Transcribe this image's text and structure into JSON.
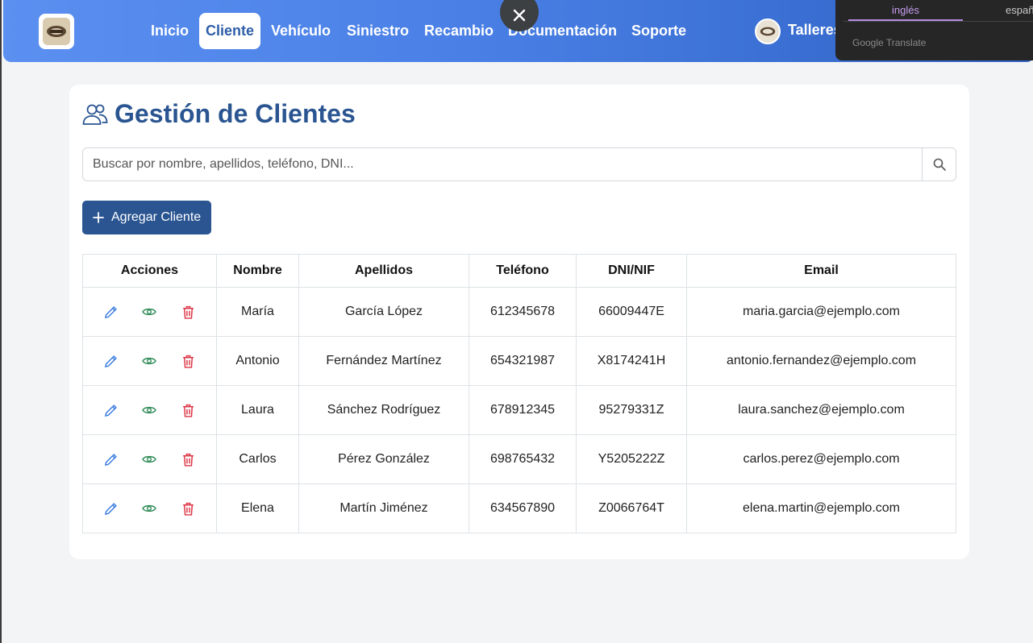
{
  "navbar": {
    "items": [
      {
        "label": "Inicio",
        "active": false
      },
      {
        "label": "Cliente",
        "active": true
      },
      {
        "label": "Vehículo",
        "active": false
      },
      {
        "label": "Siniestro",
        "active": false
      },
      {
        "label": "Recambio",
        "active": false
      },
      {
        "label": "Documentación",
        "active": false
      },
      {
        "label": "Soporte",
        "active": false
      }
    ],
    "user_label": "Talleres"
  },
  "translate": {
    "tab_selected": "inglés",
    "tab_other": "español",
    "brand": "Google Translate"
  },
  "page": {
    "title": "Gestión de Clientes",
    "title_icon": "users-icon",
    "search_placeholder": "Buscar por nombre, apellidos, teléfono, DNI...",
    "search_value": "",
    "add_button_label": "Agregar Cliente"
  },
  "table": {
    "headers": [
      "Acciones",
      "Nombre",
      "Apellidos",
      "Teléfono",
      "DNI/NIF",
      "Email"
    ],
    "rows": [
      {
        "nombre": "María",
        "apellidos": "García López",
        "telefono": "612345678",
        "dni": "66009447E",
        "email": "maria.garcia@ejemplo.com"
      },
      {
        "nombre": "Antonio",
        "apellidos": "Fernández Martínez",
        "telefono": "654321987",
        "dni": "X8174241H",
        "email": "antonio.fernandez@ejemplo.com"
      },
      {
        "nombre": "Laura",
        "apellidos": "Sánchez Rodríguez",
        "telefono": "678912345",
        "dni": "95279331Z",
        "email": "laura.sanchez@ejemplo.com"
      },
      {
        "nombre": "Carlos",
        "apellidos": "Pérez González",
        "telefono": "698765432",
        "dni": "Y5205222Z",
        "email": "carlos.perez@ejemplo.com"
      },
      {
        "nombre": "Elena",
        "apellidos": "Martín Jiménez",
        "telefono": "634567890",
        "dni": "Z0066764T",
        "email": "elena.martin@ejemplo.com"
      }
    ]
  },
  "colors": {
    "primary": "#2a5591",
    "edit": "#3b7de0",
    "view": "#2e8b57",
    "delete": "#dc3545"
  }
}
